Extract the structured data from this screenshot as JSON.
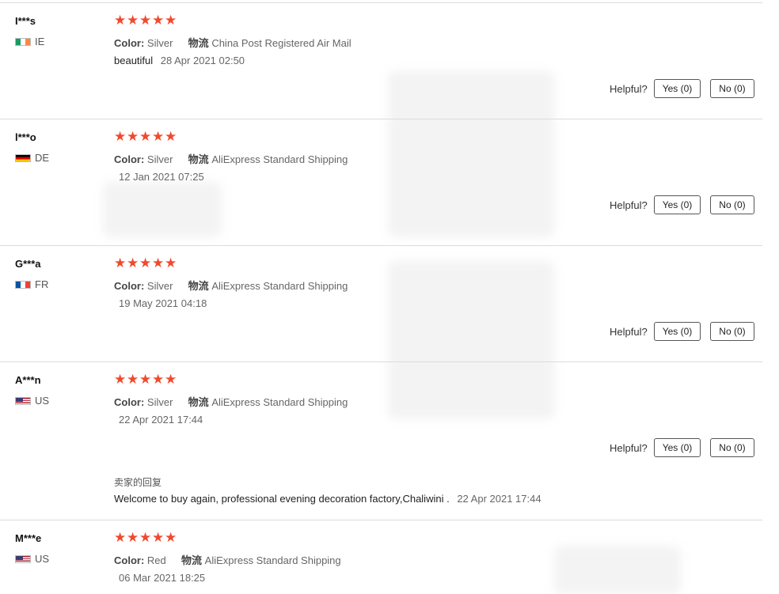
{
  "helpful": {
    "label": "Helpful?",
    "yes": "Yes (0)",
    "no": "No (0)"
  },
  "meta_labels": {
    "color": "Color:",
    "shipping": "物流"
  },
  "star_glyph": "★",
  "star_color": "#f04a2e",
  "reviews": [
    {
      "user": "I***s",
      "country": "IE",
      "color": "Silver",
      "shipping": "China Post Registered Air Mail",
      "text": "beautiful",
      "date": "28 Apr 2021 02:50"
    },
    {
      "user": "l***o",
      "country": "DE",
      "color": "Silver",
      "shipping": "AliExpress Standard Shipping",
      "text": "",
      "date": "12 Jan 2021 07:25"
    },
    {
      "user": "G***a",
      "country": "FR",
      "color": "Silver",
      "shipping": "AliExpress Standard Shipping",
      "text": "",
      "date": "19 May 2021 04:18"
    },
    {
      "user": "A***n",
      "country": "US",
      "color": "Silver",
      "shipping": "AliExpress Standard Shipping",
      "text": "",
      "date": "22 Apr 2021 17:44",
      "seller_reply_title": "卖家的回复",
      "seller_reply": "Welcome to buy again, professional evening decoration factory,Chaliwini .",
      "seller_reply_date": "22 Apr 2021 17:44"
    },
    {
      "user": "M***e",
      "country": "US",
      "color": "Red",
      "shipping": "AliExpress Standard Shipping",
      "text": "",
      "date": "06 Mar 2021 18:25"
    }
  ]
}
